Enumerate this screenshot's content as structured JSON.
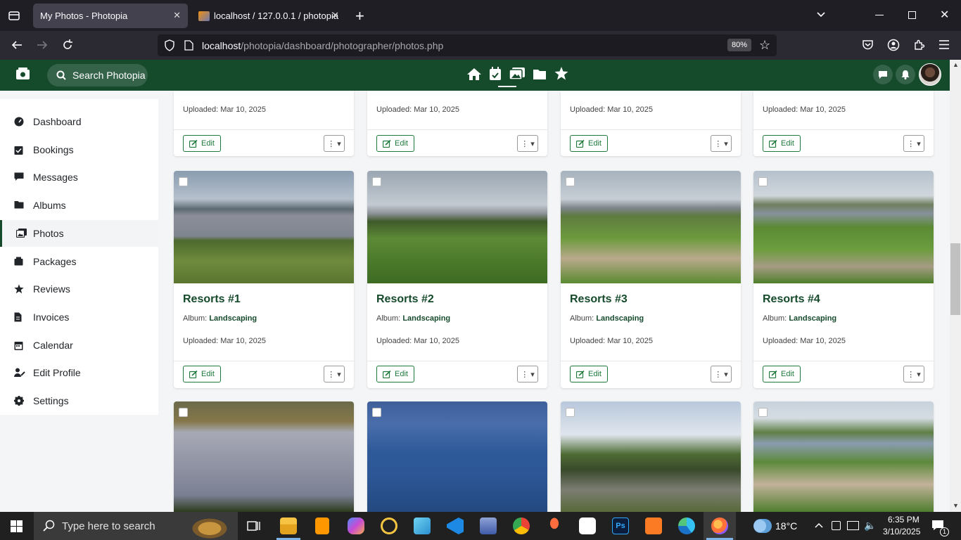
{
  "browser": {
    "tabs": [
      {
        "title": "My Photos - Photopia",
        "active": true
      },
      {
        "title": "localhost / 127.0.0.1 / photopia",
        "active": false
      }
    ],
    "url_host": "localhost",
    "url_path": "/photopia/dashboard/photographer/photos.php",
    "zoom": "80%"
  },
  "header": {
    "search_label": "Search Photopia",
    "nav_icons": [
      "home-icon",
      "calendar-check-icon",
      "images-icon",
      "folder-icon",
      "star-icon"
    ],
    "active_nav": "images-icon"
  },
  "sidebar": {
    "items": [
      {
        "label": "Dashboard",
        "icon": "gauge-icon"
      },
      {
        "label": "Bookings",
        "icon": "calendar-check-icon"
      },
      {
        "label": "Messages",
        "icon": "message-icon"
      },
      {
        "label": "Albums",
        "icon": "folder-icon"
      },
      {
        "label": "Photos",
        "icon": "images-icon",
        "active": true
      },
      {
        "label": "Packages",
        "icon": "box-icon"
      },
      {
        "label": "Reviews",
        "icon": "star-icon"
      },
      {
        "label": "Invoices",
        "icon": "invoice-icon"
      },
      {
        "label": "Calendar",
        "icon": "calendar-icon"
      },
      {
        "label": "Edit Profile",
        "icon": "user-edit-icon"
      },
      {
        "label": "Settings",
        "icon": "gear-icon"
      }
    ]
  },
  "photos": {
    "top_row": [
      {
        "uploaded": "Uploaded: Mar 10, 2025"
      },
      {
        "uploaded": "Uploaded: Mar 10, 2025"
      },
      {
        "uploaded": "Uploaded: Mar 10, 2025"
      },
      {
        "uploaded": "Uploaded: Mar 10, 2025"
      }
    ],
    "middle_row": [
      {
        "title": "Resorts #1",
        "album_label": "Album:",
        "album": "Landscaping",
        "uploaded": "Uploaded: Mar 10, 2025"
      },
      {
        "title": "Resorts #2",
        "album_label": "Album:",
        "album": "Landscaping",
        "uploaded": "Uploaded: Mar 10, 2025"
      },
      {
        "title": "Resorts #3",
        "album_label": "Album:",
        "album": "Landscaping",
        "uploaded": "Uploaded: Mar 10, 2025"
      },
      {
        "title": "Resorts #4",
        "album_label": "Album:",
        "album": "Landscaping",
        "uploaded": "Uploaded: Mar 10, 2025"
      }
    ],
    "edit_label": "Edit",
    "more_label": "⋮ ▾"
  },
  "taskbar": {
    "search_placeholder": "Type here to search",
    "weather": "18°C",
    "time": "6:35 PM",
    "date": "3/10/2025",
    "notification_count": "1"
  },
  "colors": {
    "brand": "#154a2b",
    "accent": "#1e7a3a"
  }
}
